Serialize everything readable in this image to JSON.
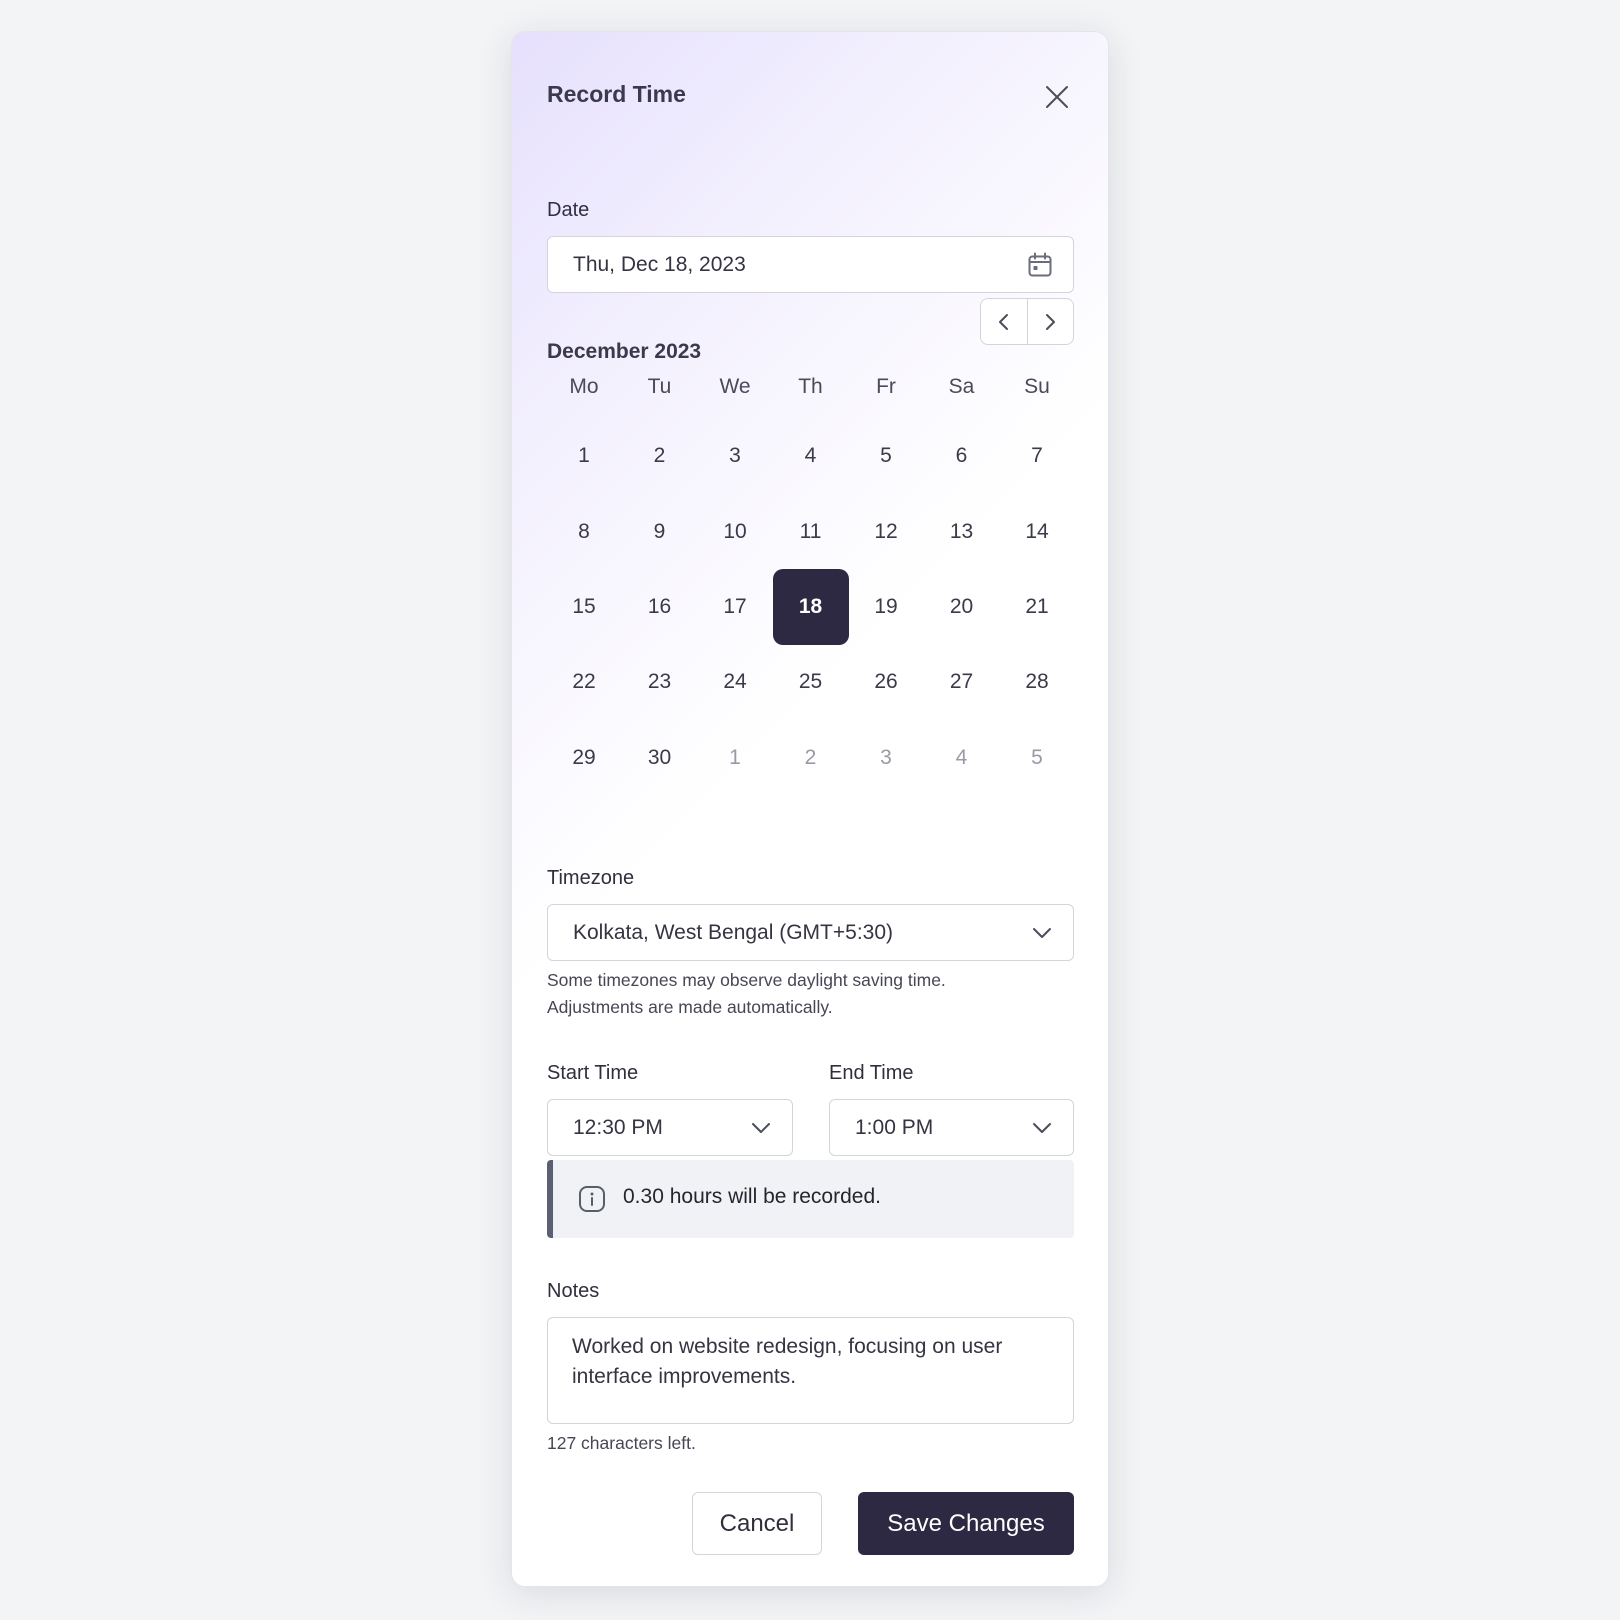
{
  "modal": {
    "title": "Record Time",
    "close_icon": "close-icon"
  },
  "date_field": {
    "label": "Date",
    "value": "Thu, Dec 18, 2023",
    "icon": "calendar-icon"
  },
  "calendar": {
    "month_label": "December 2023",
    "prev_icon": "chevron-left-icon",
    "next_icon": "chevron-right-icon",
    "weekdays": [
      "Mo",
      "Tu",
      "We",
      "Th",
      "Fr",
      "Sa",
      "Su"
    ],
    "weeks": [
      [
        "1",
        "2",
        "3",
        "4",
        "5",
        "6",
        "7"
      ],
      [
        "8",
        "9",
        "10",
        "11",
        "12",
        "13",
        "14"
      ],
      [
        "15",
        "16",
        "17",
        "18",
        "19",
        "20",
        "21"
      ],
      [
        "22",
        "23",
        "24",
        "25",
        "26",
        "27",
        "28"
      ],
      [
        "29",
        "30",
        "1",
        "2",
        "3",
        "4",
        "5"
      ]
    ],
    "selected_day": "18",
    "trailing_days_from_next_month": [
      "1",
      "2",
      "3",
      "4",
      "5"
    ]
  },
  "timezone": {
    "label": "Timezone",
    "value": "Kolkata, West Bengal (GMT+5:30)",
    "helper_line1": "Some timezones may observe daylight saving time.",
    "helper_line2": "Adjustments are made automatically."
  },
  "start_time": {
    "label": "Start Time",
    "value": "12:30 PM"
  },
  "end_time": {
    "label": "End Time",
    "value": "1:00 PM"
  },
  "info": {
    "icon": "info-icon",
    "text": "0.30 hours will be recorded."
  },
  "notes": {
    "label": "Notes",
    "value": "Worked on website redesign, focusing on user interface improvements.",
    "counter": "127 characters left."
  },
  "actions": {
    "cancel_label": "Cancel",
    "save_label": "Save Changes"
  },
  "colors": {
    "primary": "#2d2942",
    "accent_gradient": "#e6e0fd",
    "info_border": "#5a6070"
  }
}
